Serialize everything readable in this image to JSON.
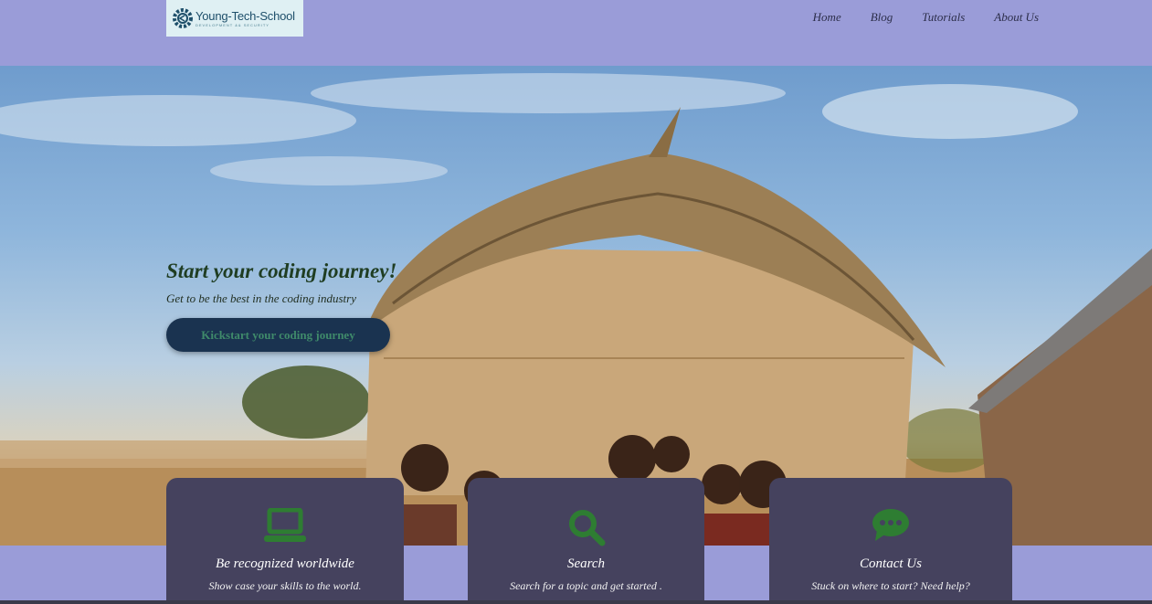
{
  "logo": {
    "name": "Young-Tech-School",
    "tagline": "DEVELOPMENT && SECURITY"
  },
  "nav": {
    "items": [
      {
        "label": "Home"
      },
      {
        "label": "Blog"
      },
      {
        "label": "Tutorials"
      },
      {
        "label": "About Us"
      }
    ]
  },
  "hero": {
    "title": "Start your coding journey!",
    "subtitle": "Get to be the best in the coding industry",
    "button_label": "Kickstart your coding journey"
  },
  "cards": [
    {
      "icon": "laptop-icon",
      "title": "Be recognized worldwide",
      "description": "Show case your skills to the world."
    },
    {
      "icon": "search-icon",
      "title": "Search",
      "description": "Search for a topic and get started ."
    },
    {
      "icon": "chat-bubble-icon",
      "title": "Contact Us",
      "description": "Stuck on where to start? Need help?"
    }
  ],
  "colors": {
    "header_bg": "#9a9cd8",
    "card_bg": "#45425e",
    "icon_green": "#2e7d32",
    "button_bg": "#1a3350"
  }
}
